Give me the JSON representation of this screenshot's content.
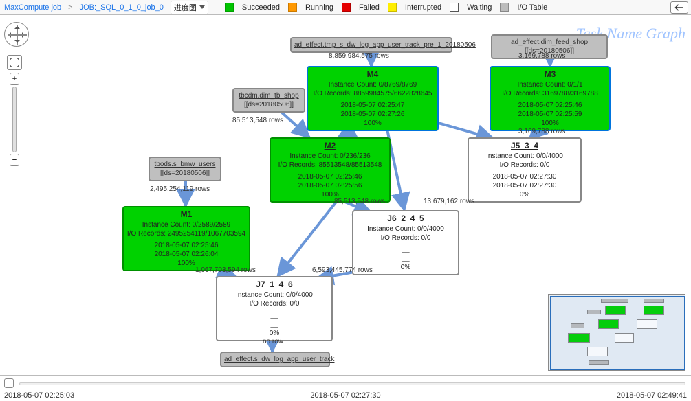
{
  "breadcrumb": {
    "root": "MaxCompute job",
    "job": "JOB:_SQL_0_1_0_job_0"
  },
  "dropdown_label": "进度图",
  "legend": {
    "succeeded": "Succeeded",
    "running": "Running",
    "failed": "Failed",
    "interrupted": "Interrupted",
    "waiting": "Waiting",
    "io": "I/O Table"
  },
  "watermark": "Task Name Graph",
  "io_tables": {
    "tA": {
      "name": "ad_effect.tmp_s_dw_log_app_user_track_pre_1_20180506",
      "part": ""
    },
    "tB": {
      "name": "ad_effect.dim_feed_shop",
      "part": "[[ds=20180506]]"
    },
    "tC": {
      "name": "tbcdm.dim_tb_shop",
      "part": "[[ds=20180506]]"
    },
    "tD": {
      "name": "tbods.s_bmw_users",
      "part": "[[ds=20180506]]"
    },
    "tOut": {
      "name": "ad_effect.s_dw_log_app_user_track",
      "part": ""
    }
  },
  "nodes": {
    "M4": {
      "title": "M4",
      "l1": "Instance Count: 0/8769/8769",
      "l2": "I/O Records: 8859984575/6622828645",
      "l3": "2018-05-07 02:25:47",
      "l4": "2018-05-07 02:27:26",
      "pct": "100%"
    },
    "M3": {
      "title": "M3",
      "l1": "Instance Count: 0/1/1",
      "l2": "I/O Records: 3169788/3169788",
      "l3": "2018-05-07 02:25:46",
      "l4": "2018-05-07 02:25:59",
      "pct": "100%"
    },
    "M2": {
      "title": "M2",
      "l1": "Instance Count: 0/236/236",
      "l2": "I/O Records: 85513548/85513548",
      "l3": "2018-05-07 02:25:46",
      "l4": "2018-05-07 02:25:56",
      "pct": "100%"
    },
    "M1": {
      "title": "M1",
      "l1": "Instance Count: 0/2589/2589",
      "l2": "I/O Records: 2495254119/1067703594",
      "l3": "2018-05-07 02:25:46",
      "l4": "2018-05-07 02:26:04",
      "pct": "100%"
    },
    "J5": {
      "title": "J5_3_4",
      "l1": "Instance Count: 0/0/4000",
      "l2": "I/O Records: 0/0",
      "l3": "2018-05-07 02:27:30",
      "l4": "2018-05-07 02:27:30",
      "pct": "0%"
    },
    "J6": {
      "title": "J6_2_4_5",
      "l1": "Instance Count: 0/0/4000",
      "l2": "I/O Records: 0/0",
      "l3": "__",
      "l4": "__",
      "pct": "0%"
    },
    "J7": {
      "title": "J7_1_4_6",
      "l1": "Instance Count: 0/0/4000",
      "l2": "I/O Records: 0/0",
      "l3": "__",
      "l4": "__",
      "pct": "0%"
    }
  },
  "edge_labels": {
    "eA_M4": "8,859,984,575 rows",
    "eB_M3": "3,169,788 rows",
    "eC_M2": "85,513,548 rows",
    "eD_M1": "2,495,254,119 rows",
    "eM3_J5": "3,169,788 rows",
    "eM4_J6": "85,513,548 rows",
    "eM4_J5": "13,679,162 rows",
    "eM1_J7": "1,067,703,594 rows",
    "eJ6_J7": "6,593,445,774 rows",
    "eJ7_out": "no row"
  },
  "timeline": {
    "start": "2018-05-07 02:25:03",
    "mid": "2018-05-07 02:27:30",
    "end": "2018-05-07 02:49:41"
  }
}
